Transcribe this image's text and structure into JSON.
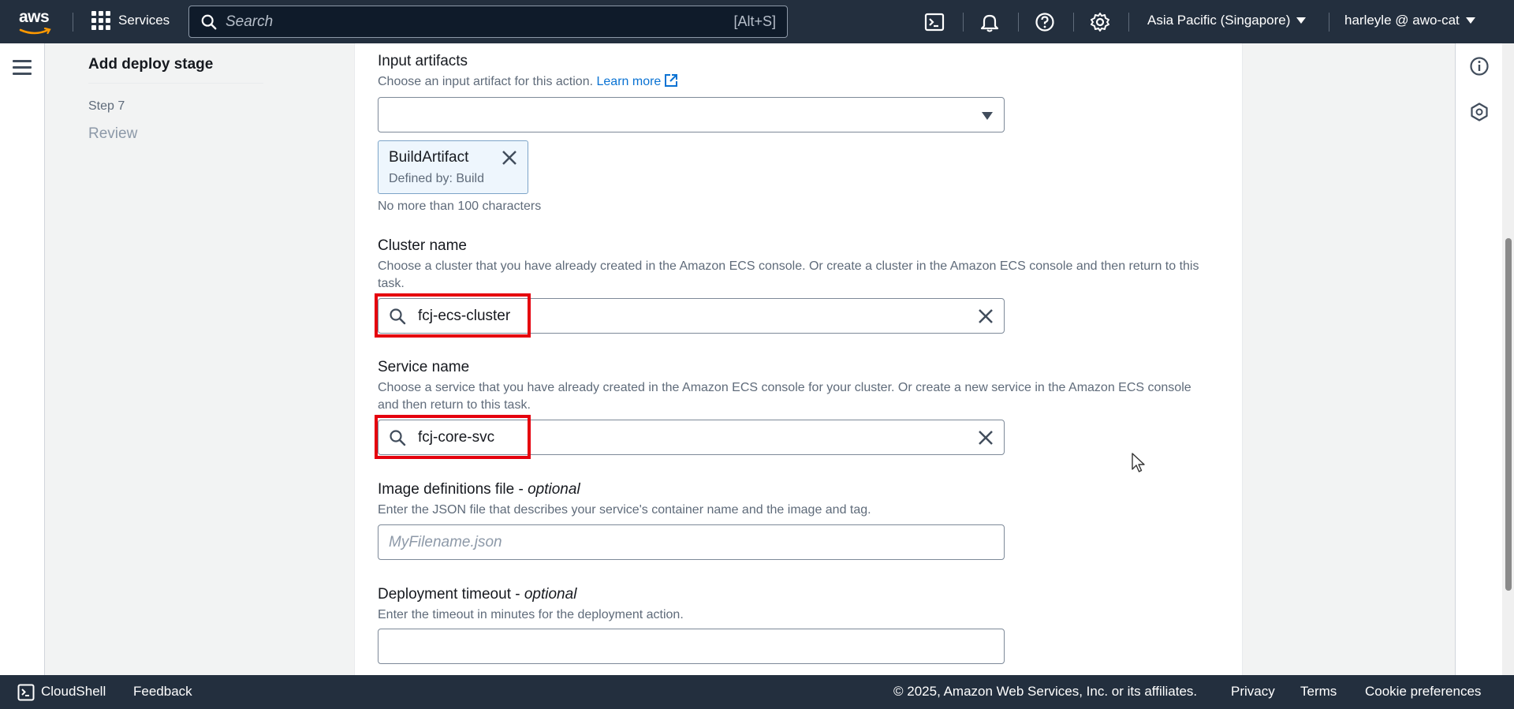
{
  "topnav": {
    "logo_text": "aws",
    "services_label": "Services",
    "search_placeholder": "Search",
    "search_shortcut": "[Alt+S]",
    "region_label": "Asia Pacific (Singapore)",
    "user_label": "harleyle @ awo-cat",
    "icons": [
      "cloudshell-icon",
      "bell-icon",
      "help-icon",
      "settings-icon"
    ]
  },
  "steps_nav": {
    "title": "Add deploy stage",
    "step_number": "Step 7",
    "step_name": "Review"
  },
  "form": {
    "input_artifacts": {
      "label": "Input artifacts",
      "description": "Choose an input artifact for this action.",
      "learn_more": "Learn more",
      "selected_value": "",
      "token_name": "BuildArtifact",
      "token_defined_by": "Defined by: Build",
      "constraint": "No more than 100 characters"
    },
    "cluster_name": {
      "label": "Cluster name",
      "description": "Choose a cluster that you have already created in the Amazon ECS console. Or create a cluster in the Amazon ECS console and then return to this task.",
      "value": "fcj-ecs-cluster"
    },
    "service_name": {
      "label": "Service name",
      "description": "Choose a service that you have already created in the Amazon ECS console for your cluster. Or create a new service in the Amazon ECS console and then return to this task.",
      "value": "fcj-core-svc"
    },
    "image_definitions": {
      "label": "Image definitions file -",
      "optional": "optional",
      "description": "Enter the JSON file that describes your service's container name and the image and tag.",
      "placeholder": "MyFilename.json",
      "value": ""
    },
    "deployment_timeout": {
      "label": "Deployment timeout -",
      "optional": "optional",
      "description": "Enter the timeout in minutes for the deployment action.",
      "value": ""
    }
  },
  "footer": {
    "cloudshell": "CloudShell",
    "feedback": "Feedback",
    "copyright": "© 2025, Amazon Web Services, Inc. or its affiliates.",
    "privacy": "Privacy",
    "terms": "Terms",
    "cookie": "Cookie preferences"
  },
  "colors": {
    "nav_bg": "#232f3e",
    "link": "#0972d3",
    "highlight": "#e5000e",
    "token_bg": "#eef6fd"
  }
}
